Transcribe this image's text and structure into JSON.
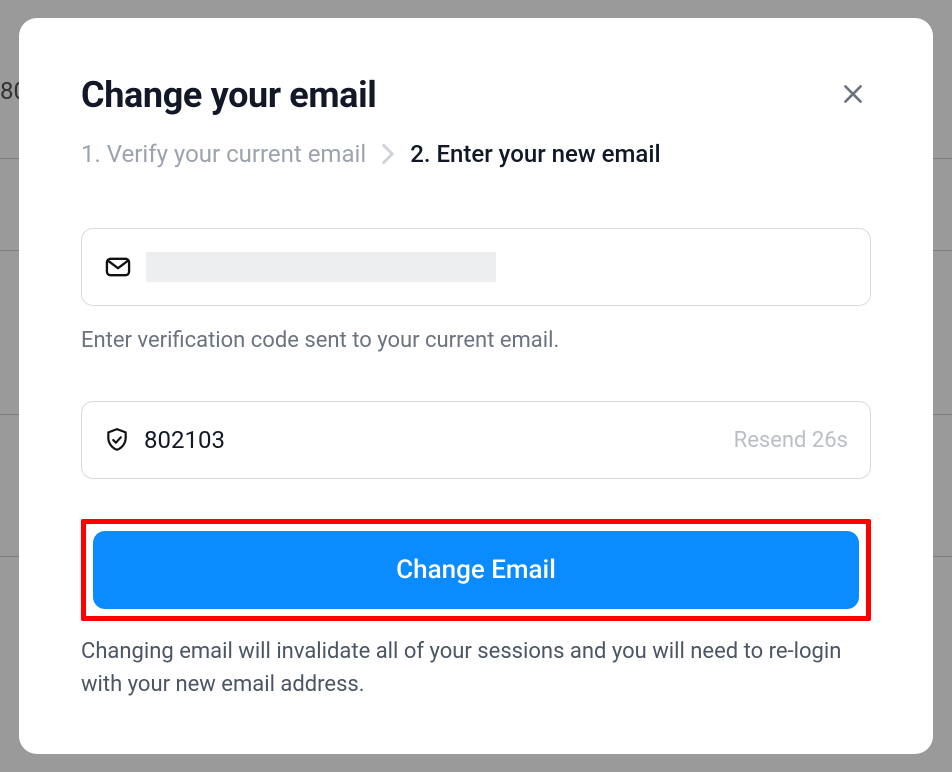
{
  "background": {
    "partial_text": "80"
  },
  "modal": {
    "title": "Change your email",
    "steps": {
      "step1": "1. Verify your current email",
      "step2": "2. Enter your new email"
    },
    "email_field": {
      "value": ""
    },
    "helper": "Enter verification code sent to your current email.",
    "code_field": {
      "value": "802103",
      "resend_label": "Resend 26s"
    },
    "submit_label": "Change Email",
    "warning": "Changing email will invalidate all of your sessions and you will need to re-login with your new email address."
  }
}
